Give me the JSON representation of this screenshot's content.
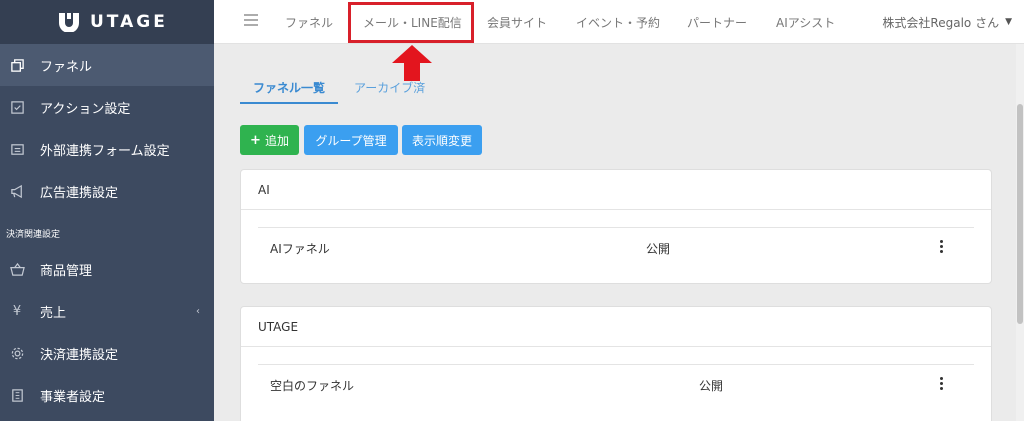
{
  "app": {
    "logo_text": "UTAGE"
  },
  "sidebar": {
    "items_top": [
      {
        "label": "ファネル",
        "icon": "funnel-icon"
      },
      {
        "label": "アクション設定",
        "icon": "checkbox-icon"
      },
      {
        "label": "外部連携フォーム設定",
        "icon": "form-icon"
      },
      {
        "label": "広告連携設定",
        "icon": "megaphone-icon"
      }
    ],
    "section_head": "決済関連設定",
    "items_bottom": [
      {
        "label": "商品管理",
        "icon": "basket-icon"
      },
      {
        "label": "売上",
        "icon": "yen-icon"
      },
      {
        "label": "決済連携設定",
        "icon": "gear-icon"
      },
      {
        "label": "事業者設定",
        "icon": "building-icon"
      }
    ]
  },
  "topbar": {
    "nav": [
      "ファネル",
      "メール・LINE配信",
      "会員サイト",
      "イベント・予約",
      "パートナー",
      "AIアシスト"
    ],
    "user": "株式会社Regalo さん"
  },
  "tabs": [
    "ファネル一覧",
    "アーカイブ済"
  ],
  "buttons": {
    "add": "追加",
    "group": "グループ管理",
    "order": "表示順変更"
  },
  "groups": [
    {
      "title": "AI",
      "rows": [
        {
          "name": "AIファネル",
          "status": "公開"
        }
      ]
    },
    {
      "title": "UTAGE",
      "rows": [
        {
          "name": "空白のファネル",
          "status": "公開"
        }
      ]
    }
  ],
  "colors": {
    "sidebar": "#3d4a60",
    "highlight": "#d8202a",
    "accent": "#3a8ad1",
    "green": "#2fb34f",
    "blue": "#3b9ff0"
  }
}
